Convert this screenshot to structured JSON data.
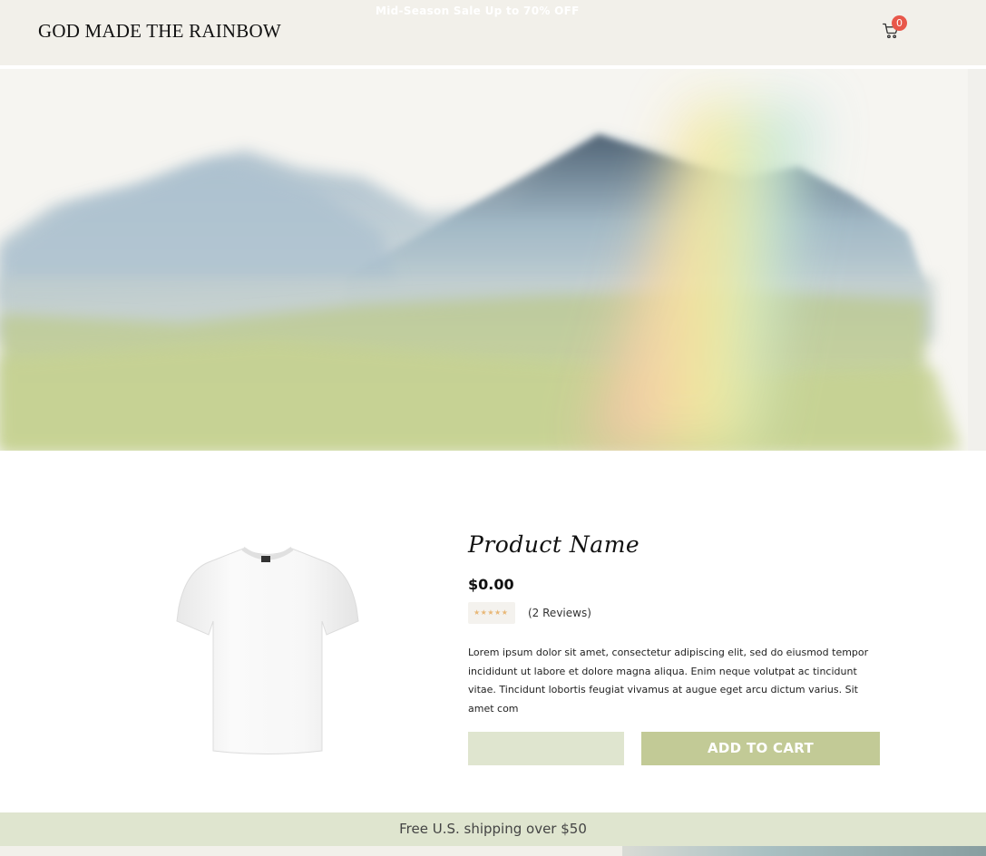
{
  "header": {
    "promo": "Mid-Season Sale Up to 70% OFF",
    "logo": "GOD MADE THE RAINBOW",
    "cart_count": "0",
    "cart_icon": "cart-icon"
  },
  "product": {
    "name": "Product Name",
    "price": "$0.00",
    "stars": "★★★★★",
    "reviews": "(2 Reviews)",
    "description": "Lorem ipsum dolor sit amet, consectetur adipiscing elit, sed do eiusmod tempor incididunt ut labore et dolore magna aliqua. Enim neque volutpat ac tincidunt vitae. Tincidunt lobortis feugiat vivamus at augue eget arcu dictum varius. Sit amet com",
    "add_to_cart": "ADD TO CART",
    "quantity_value": ""
  },
  "shipping": {
    "text": "Free U.S. shipping over $50"
  },
  "colors": {
    "header_bg": "#f2f0ea",
    "accent": "#c2ca96",
    "accent_light": "#dfe5cf",
    "badge": "#e8574a"
  }
}
